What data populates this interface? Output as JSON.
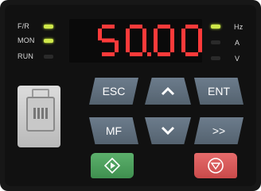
{
  "left_indicators": [
    {
      "label": "F/R",
      "state": "on"
    },
    {
      "label": "MON",
      "state": "on"
    },
    {
      "label": "RUN",
      "state": "off"
    }
  ],
  "right_indicators": [
    {
      "label": "Hz",
      "state": "on"
    },
    {
      "label": "A",
      "state": "off"
    },
    {
      "label": "V",
      "state": "off"
    }
  ],
  "display": {
    "value": "50.00",
    "color": "#ff3a3a"
  },
  "keys": {
    "esc": "ESC",
    "ent": "ENT",
    "mf": "MF",
    "shift": ">>"
  },
  "icons": {
    "up": "up-arrow-icon",
    "down": "down-arrow-icon",
    "run": "run-icon",
    "stop": "stop-icon",
    "port": "rj45-port-icon"
  },
  "colors": {
    "led_on": "#cfe84a",
    "key": "#607080",
    "run": "#4caf5f",
    "stop": "#d85a5a"
  }
}
